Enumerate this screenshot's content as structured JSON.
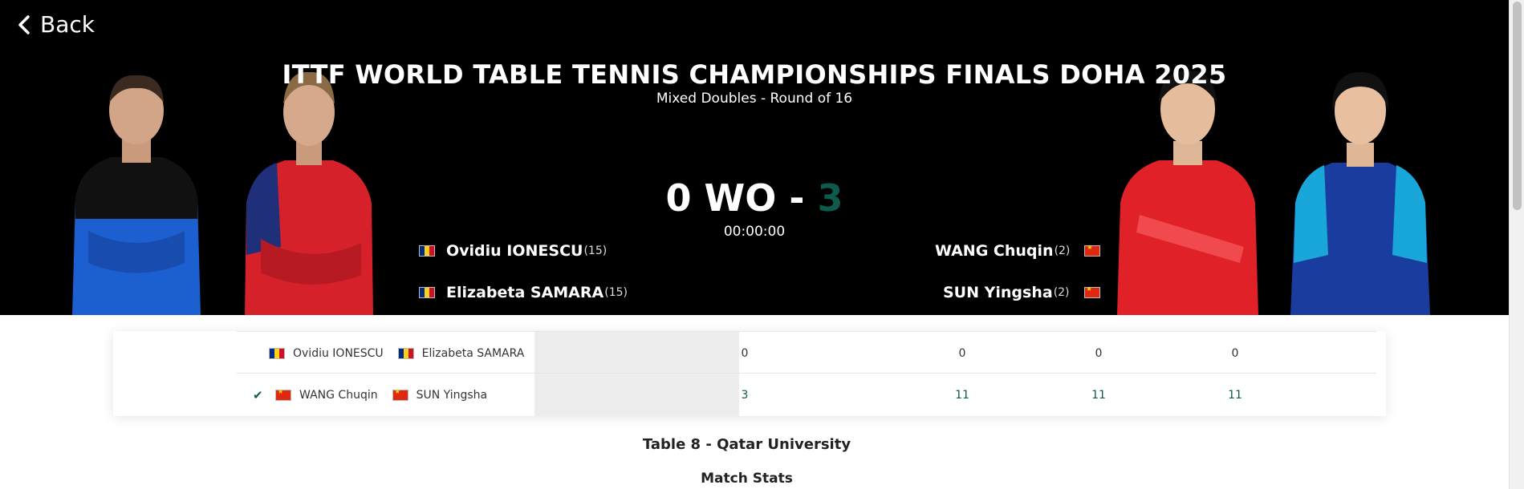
{
  "nav": {
    "back_label": "Back"
  },
  "event": {
    "title": "ITTF WORLD TABLE TENNIS CHAMPIONSHIPS FINALS DOHA 2025",
    "subtitle": "Mixed Doubles - Round of 16"
  },
  "score": {
    "left": "0",
    "wo": "WO",
    "sep": "-",
    "right": "3",
    "time": "00:00:00"
  },
  "team_left": [
    {
      "name": "Ovidiu IONESCU",
      "seed": "(15)",
      "flag": "ro"
    },
    {
      "name": "Elizabeta SAMARA",
      "seed": "(15)",
      "flag": "ro"
    }
  ],
  "team_right": [
    {
      "name": "WANG Chuqin",
      "seed": "(2)",
      "flag": "cn"
    },
    {
      "name": "SUN Yingsha",
      "seed": "(2)",
      "flag": "cn"
    }
  ],
  "table": {
    "rows": [
      {
        "winner": false,
        "p1": "Ovidiu IONESCU",
        "p2": "Elizabeta SAMARA",
        "total": "0",
        "games": [
          "0",
          "0",
          "0"
        ]
      },
      {
        "winner": true,
        "p1": "WANG Chuqin",
        "p2": "SUN Yingsha",
        "total": "3",
        "games": [
          "11",
          "11",
          "11"
        ]
      }
    ]
  },
  "venue": "Table 8 - Qatar University",
  "stats_heading": "Match Stats",
  "colors": {
    "winner": "#0e5a4d",
    "hero_bg": "#000000"
  }
}
